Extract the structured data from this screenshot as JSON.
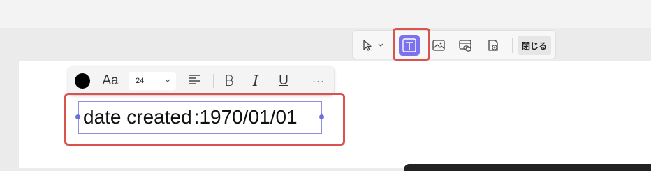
{
  "tool_toolbar": {
    "tools": [
      {
        "name": "select",
        "icon": "pointer-icon"
      },
      {
        "name": "text",
        "icon": "text-icon",
        "active": true
      },
      {
        "name": "image",
        "icon": "image-icon"
      },
      {
        "name": "link",
        "icon": "link-icon"
      },
      {
        "name": "stamp",
        "icon": "stamp-icon"
      }
    ],
    "close_label": "閉じる",
    "active_color": "#7b72f0"
  },
  "format_toolbar": {
    "text_color": "#000000",
    "font_label": "Aa",
    "font_size": "24",
    "bold_label": "B",
    "italic_label": "I",
    "underline_label": "U",
    "more_label": "···"
  },
  "text_box": {
    "text_before_caret": "date created",
    "text_after_caret": ":1970/01/01"
  },
  "highlight_color": "#d9534f"
}
